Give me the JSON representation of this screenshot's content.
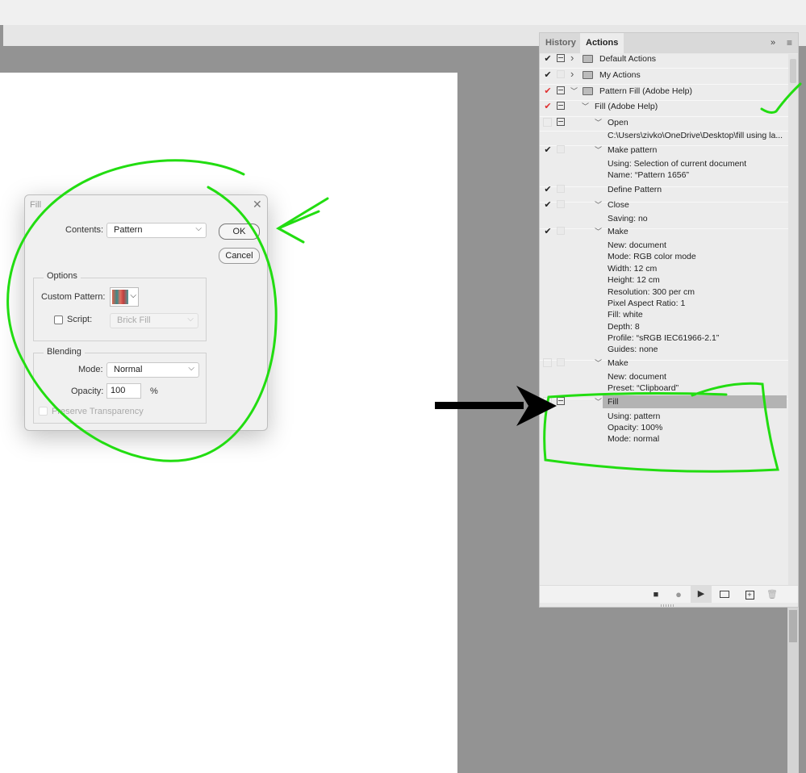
{
  "dialog": {
    "title": "Fill",
    "contents_label": "Contents:",
    "contents_value": "Pattern",
    "ok": "OK",
    "cancel": "Cancel",
    "options_title": "Options",
    "custom_pattern_label": "Custom Pattern:",
    "script_label": "Script:",
    "script_value": "Brick Fill",
    "script_checked": false,
    "blending_title": "Blending",
    "mode_label": "Mode:",
    "mode_value": "Normal",
    "opacity_label": "Opacity:",
    "opacity_value": "100",
    "opacity_unit": "%",
    "preserve_label": "Preserve Transparency",
    "preserve_checked": false
  },
  "panel": {
    "tabs": [
      {
        "label": "History",
        "active": false
      },
      {
        "label": "Actions",
        "active": true
      }
    ],
    "rows": [
      {
        "kind": "set",
        "check": "✔",
        "check_color": "#222",
        "dialog": "on",
        "expanded": false,
        "text": "Default Actions"
      },
      {
        "kind": "set",
        "check": "✔",
        "check_color": "#222",
        "dialog": "off",
        "expanded": false,
        "text": "My Actions"
      },
      {
        "kind": "set",
        "check": "✔",
        "check_color": "#e03030",
        "dialog": "on",
        "expanded": true,
        "text": "Pattern Fill (Adobe Help)"
      },
      {
        "kind": "action",
        "check": "✔",
        "check_color": "#e03030",
        "dialog": "on",
        "expanded": true,
        "text": "Fill (Adobe Help)"
      },
      {
        "kind": "command",
        "check": "",
        "dialog": "on",
        "expanded": true,
        "text": "Open"
      },
      {
        "kind": "detail",
        "text": "C:\\Users\\zivko\\OneDrive\\Desktop\\fill using la..."
      },
      {
        "kind": "command",
        "check": "✔",
        "check_color": "#222",
        "dialog": "off",
        "expanded": true,
        "text": "Make pattern"
      },
      {
        "kind": "detail",
        "text": "Using: Selection of current document"
      },
      {
        "kind": "detail",
        "text": "Name:  “Pattern 1656”"
      },
      {
        "kind": "command",
        "check": "✔",
        "check_color": "#222",
        "dialog": "off",
        "expanded": null,
        "text": "Define Pattern"
      },
      {
        "kind": "command",
        "check": "✔",
        "check_color": "#222",
        "dialog": "off",
        "expanded": true,
        "text": "Close"
      },
      {
        "kind": "detail",
        "text": "Saving: no"
      },
      {
        "kind": "command",
        "check": "✔",
        "check_color": "#222",
        "dialog": "off",
        "expanded": true,
        "text": "Make"
      },
      {
        "kind": "detail",
        "text": "New: document"
      },
      {
        "kind": "detail",
        "text": "Mode: RGB color mode"
      },
      {
        "kind": "detail",
        "text": "Width: 12 cm"
      },
      {
        "kind": "detail",
        "text": "Height: 12 cm"
      },
      {
        "kind": "detail",
        "text": "Resolution: 300 per cm"
      },
      {
        "kind": "detail",
        "text": "Pixel Aspect Ratio: 1"
      },
      {
        "kind": "detail",
        "text": "Fill: white"
      },
      {
        "kind": "detail",
        "text": "Depth: 8"
      },
      {
        "kind": "detail",
        "text": "Profile:  “sRGB IEC61966-2.1”"
      },
      {
        "kind": "detail",
        "text": "Guides: none"
      },
      {
        "kind": "command",
        "check": "",
        "dialog": "off",
        "expanded": true,
        "text": "Make"
      },
      {
        "kind": "detail",
        "text": "New: document"
      },
      {
        "kind": "detail",
        "text": "Preset:  “Clipboard”"
      },
      {
        "kind": "command",
        "check": "",
        "dialog": "on",
        "expanded": true,
        "text": "Fill",
        "selected": true
      },
      {
        "kind": "detail",
        "text": "Using: pattern"
      },
      {
        "kind": "detail",
        "text": "Opacity: 100%"
      },
      {
        "kind": "detail",
        "text": "Mode: normal"
      }
    ],
    "footer_icons": [
      "stop-icon",
      "record-icon",
      "play-icon",
      "new-set-icon",
      "new-action-icon",
      "delete-icon"
    ]
  },
  "colors": {
    "annotation": "#22dd11",
    "selected_row": "#b3b3b3",
    "error_check": "#e03030"
  }
}
